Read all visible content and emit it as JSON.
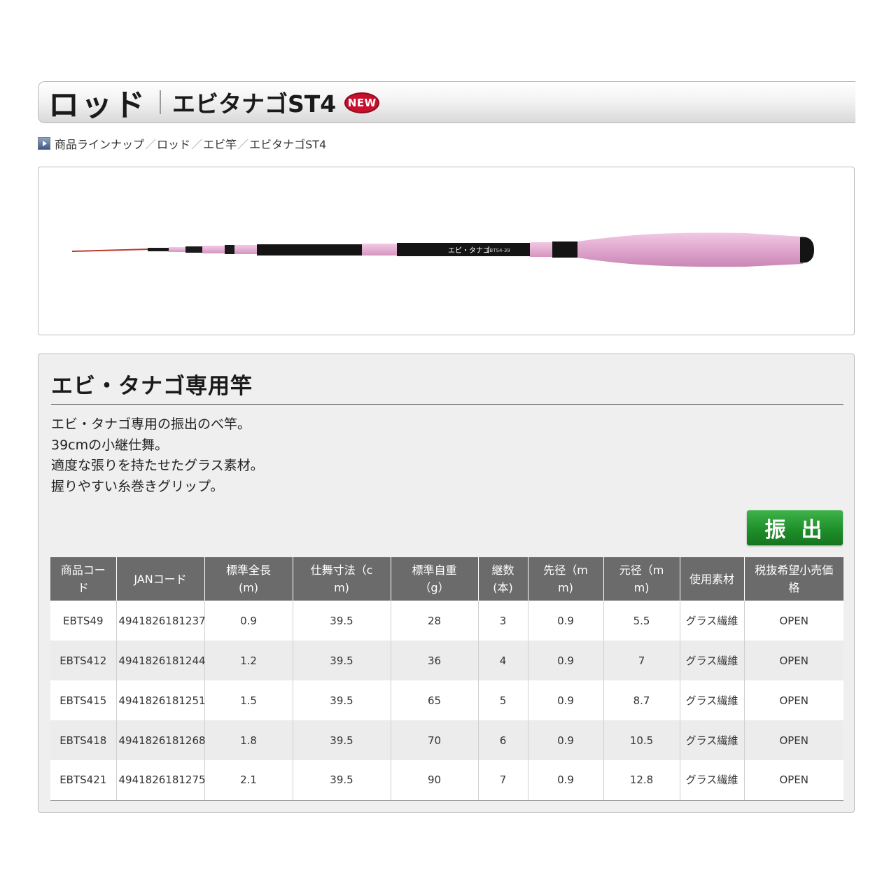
{
  "header": {
    "title": "ロッド",
    "subtitle": "エビタナゴST4",
    "badge": "NEW"
  },
  "breadcrumb": {
    "items": [
      "商品ラインナップ",
      "ロッド",
      "エビ竿",
      "エビタナゴST4"
    ],
    "separator": "／"
  },
  "product_image": {
    "rod_label": "エビ・タナゴ",
    "rod_code": "EBTS4-39"
  },
  "section": {
    "title": "エビ・タナゴ専用竿",
    "description": [
      "エビ・タナゴ専用の振出のべ竿。",
      "39cmの小継仕舞。",
      "適度な張りを持たせたグラス素材。",
      "握りやすい糸巻きグリップ。"
    ],
    "type_button": "振出"
  },
  "table": {
    "headers": [
      [
        "商品コー",
        "ド"
      ],
      [
        "JANコード"
      ],
      [
        "標準全長",
        "(m)"
      ],
      [
        "仕舞寸法（c",
        "m)"
      ],
      [
        "標準自重",
        "（g）"
      ],
      [
        "継数",
        "(本)"
      ],
      [
        "先径（m",
        "m)"
      ],
      [
        "元径（m",
        "m)"
      ],
      [
        "使用素材"
      ],
      [
        "税抜希望小売価",
        "格"
      ]
    ],
    "rows": [
      [
        "EBTS49",
        "4941826181237",
        "0.9",
        "39.5",
        "28",
        "3",
        "0.9",
        "5.5",
        "グラス繊維",
        "OPEN"
      ],
      [
        "EBTS412",
        "4941826181244",
        "1.2",
        "39.5",
        "36",
        "4",
        "0.9",
        "7",
        "グラス繊維",
        "OPEN"
      ],
      [
        "EBTS415",
        "4941826181251",
        "1.5",
        "39.5",
        "65",
        "5",
        "0.9",
        "8.7",
        "グラス繊維",
        "OPEN"
      ],
      [
        "EBTS418",
        "4941826181268",
        "1.8",
        "39.5",
        "70",
        "6",
        "0.9",
        "10.5",
        "グラス繊維",
        "OPEN"
      ],
      [
        "EBTS421",
        "4941826181275",
        "2.1",
        "39.5",
        "90",
        "7",
        "0.9",
        "12.8",
        "グラス繊維",
        "OPEN"
      ]
    ]
  },
  "colors": {
    "accent_green": "#1f8f2a",
    "new_badge_red": "#c8102e",
    "table_header": "#6b6b6b",
    "rod_pink": "#e2a9cf",
    "rod_black": "#141414"
  }
}
